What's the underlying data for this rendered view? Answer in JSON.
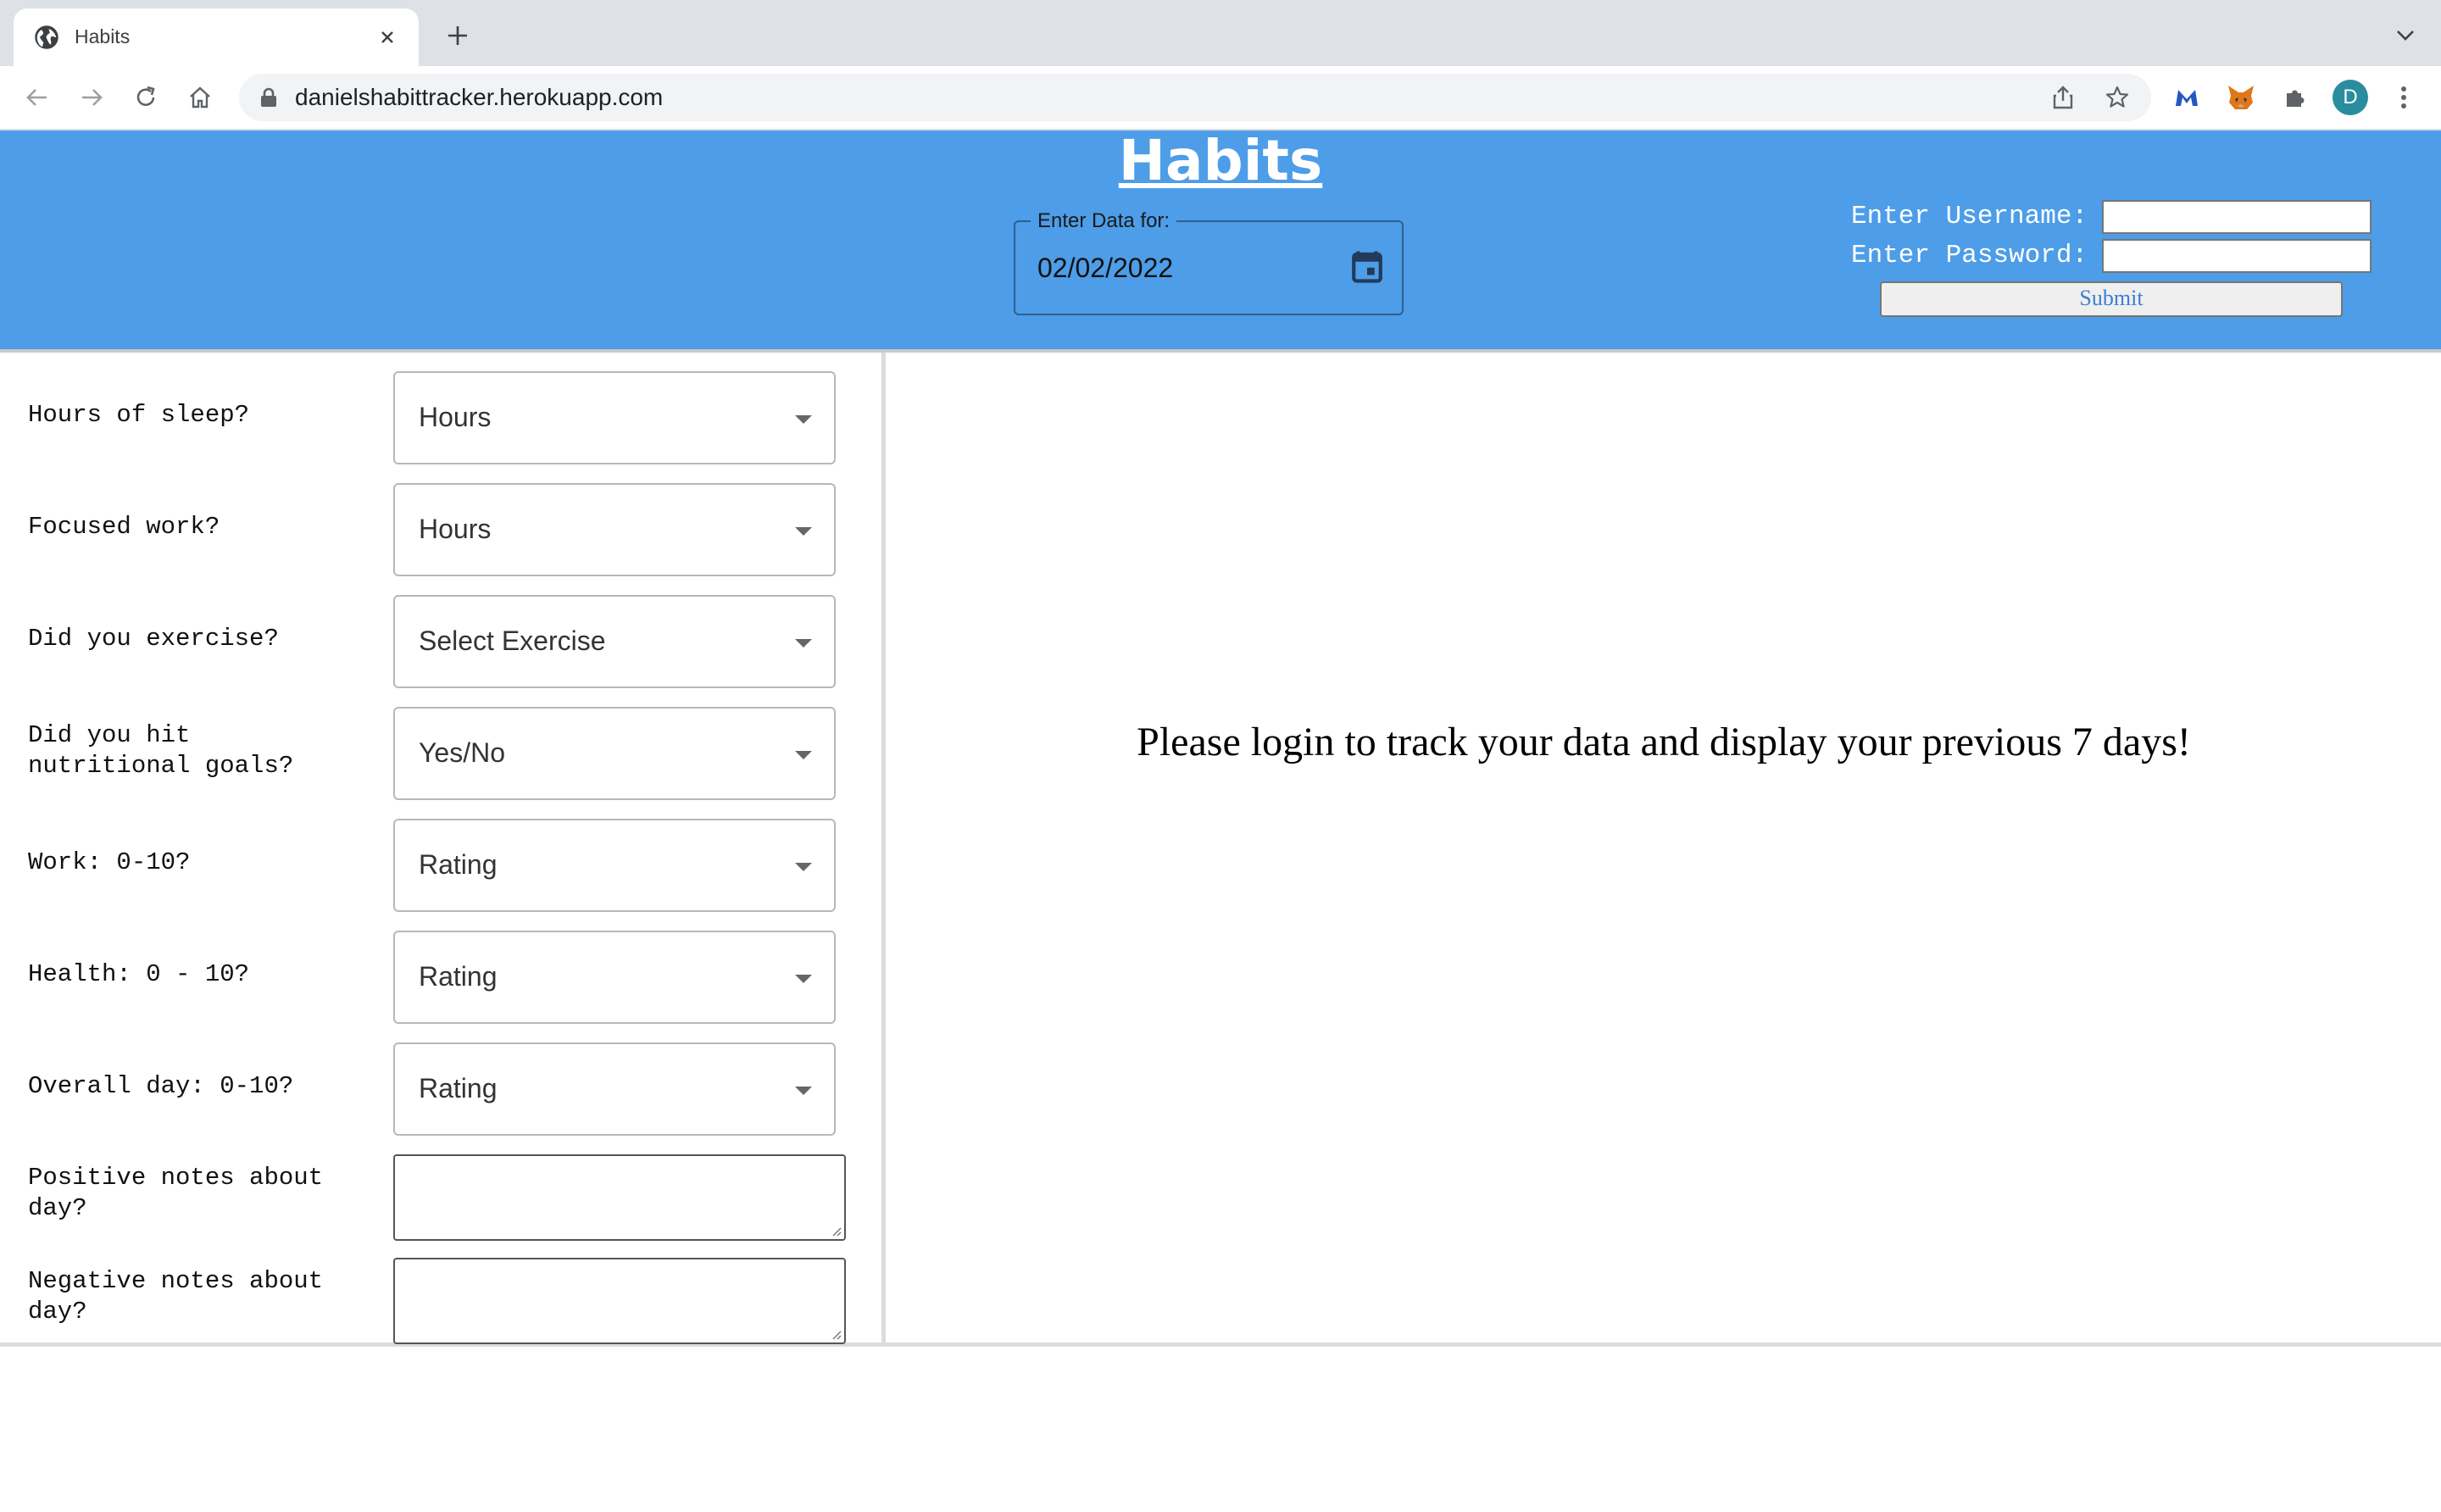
{
  "browser": {
    "tab_title": "Habits",
    "url": "danielshabittracker.herokuapp.com",
    "profile_initial": "D"
  },
  "header": {
    "title": "Habits",
    "date_label": "Enter Data for:",
    "date_value": "02/02/2022",
    "username_label": "Enter Username:",
    "password_label": "Enter Password:",
    "submit_label": "Submit",
    "background_color": "#4d9de8"
  },
  "form": {
    "questions": [
      {
        "label": "Hours of sleep?",
        "value": "Hours"
      },
      {
        "label": "Focused work?",
        "value": "Hours"
      },
      {
        "label": "Did you exercise?",
        "value": "Select Exercise"
      },
      {
        "label": "Did you hit nutritional goals?",
        "value": "Yes/No"
      },
      {
        "label": "Work: 0-10?",
        "value": "Rating"
      },
      {
        "label": "Health: 0 - 10?",
        "value": "Rating"
      },
      {
        "label": "Overall day: 0-10?",
        "value": "Rating"
      }
    ],
    "notes": [
      {
        "label": "Positive notes about day?"
      },
      {
        "label": "Negative notes about day?"
      }
    ]
  },
  "main": {
    "message": "Please login to track your data and display your previous 7 days!"
  }
}
